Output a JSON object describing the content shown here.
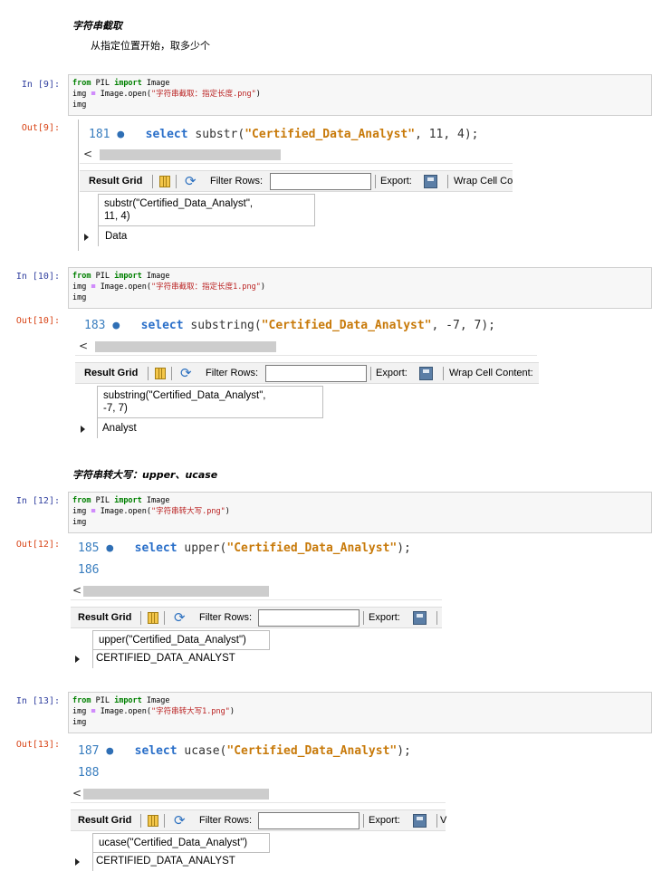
{
  "sections": {
    "substr_heading": "字符串截取",
    "substr_desc": "从指定位置开始，取多少个",
    "upper_heading": "字符串转大写：upper、ucase"
  },
  "code_common": {
    "from_kw": "from",
    "module": " PIL ",
    "import_kw": "import",
    "name": " Image",
    "img_assign": "img ",
    "eq": "=",
    "open_call": " Image.open(",
    "close_paren": ")",
    "img": "img"
  },
  "cells": [
    {
      "in_prompt": "In  [9]:",
      "out_prompt": "Out[9]:",
      "filename": "\"字符串截取：指定长度.png\"",
      "line_no": "181",
      "sql_kw": "select",
      "sql_fn": " substr(",
      "sql_str": "\"Certified_Data_Analyst\"",
      "sql_args": ", 11, 4);",
      "toolbar": {
        "result_grid": "Result Grid",
        "filter_rows": "Filter Rows:",
        "export": "Export:",
        "wrap": "Wrap Cell Co"
      },
      "column_header_1": "substr(\"Certified_Data_Analyst\",",
      "column_header_2": "11, 4)",
      "value": "Data"
    },
    {
      "in_prompt": "In  [10]:",
      "out_prompt": "Out[10]:",
      "filename": "\"字符串截取：指定长度1.png\"",
      "line_no": "183",
      "sql_kw": "select",
      "sql_fn": " substring(",
      "sql_str": "\"Certified_Data_Analyst\"",
      "sql_args": ", -7, 7);",
      "toolbar": {
        "result_grid": "Result Grid",
        "filter_rows": "Filter Rows:",
        "export": "Export:",
        "wrap": "Wrap Cell Content:"
      },
      "column_header_1": "substring(\"Certified_Data_Analyst\",",
      "column_header_2": "-7, 7)",
      "value": "Analyst"
    },
    {
      "in_prompt": "In  [12]:",
      "out_prompt": "Out[12]:",
      "filename": "\"字符串转大写.png\"",
      "line_no": "185",
      "line_no_2": "186",
      "sql_kw": "select",
      "sql_fn": " upper(",
      "sql_str": "\"Certified_Data_Analyst\"",
      "sql_args": ");",
      "toolbar": {
        "result_grid": "Result Grid",
        "filter_rows": "Filter Rows:",
        "export": "Export:"
      },
      "column_header_1": "upper(\"Certified_Data_Analyst\")",
      "value": "CERTIFIED_DATA_ANALYST"
    },
    {
      "in_prompt": "In  [13]:",
      "out_prompt": "Out[13]:",
      "filename": "\"字符串转大写1.png\"",
      "line_no": "187",
      "line_no_2": "188",
      "sql_kw": "select",
      "sql_fn": " ucase(",
      "sql_str": "\"Certified_Data_Analyst\"",
      "sql_args": ");",
      "toolbar": {
        "result_grid": "Result Grid",
        "filter_rows": "Filter Rows:",
        "export": "Export:",
        "wrap": "V"
      },
      "column_header_1": "ucase(\"Certified_Data_Analyst\")",
      "value": "CERTIFIED_DATA_ANALYST"
    }
  ],
  "ui": {
    "scroll_left": "<",
    "bullet": "●"
  }
}
